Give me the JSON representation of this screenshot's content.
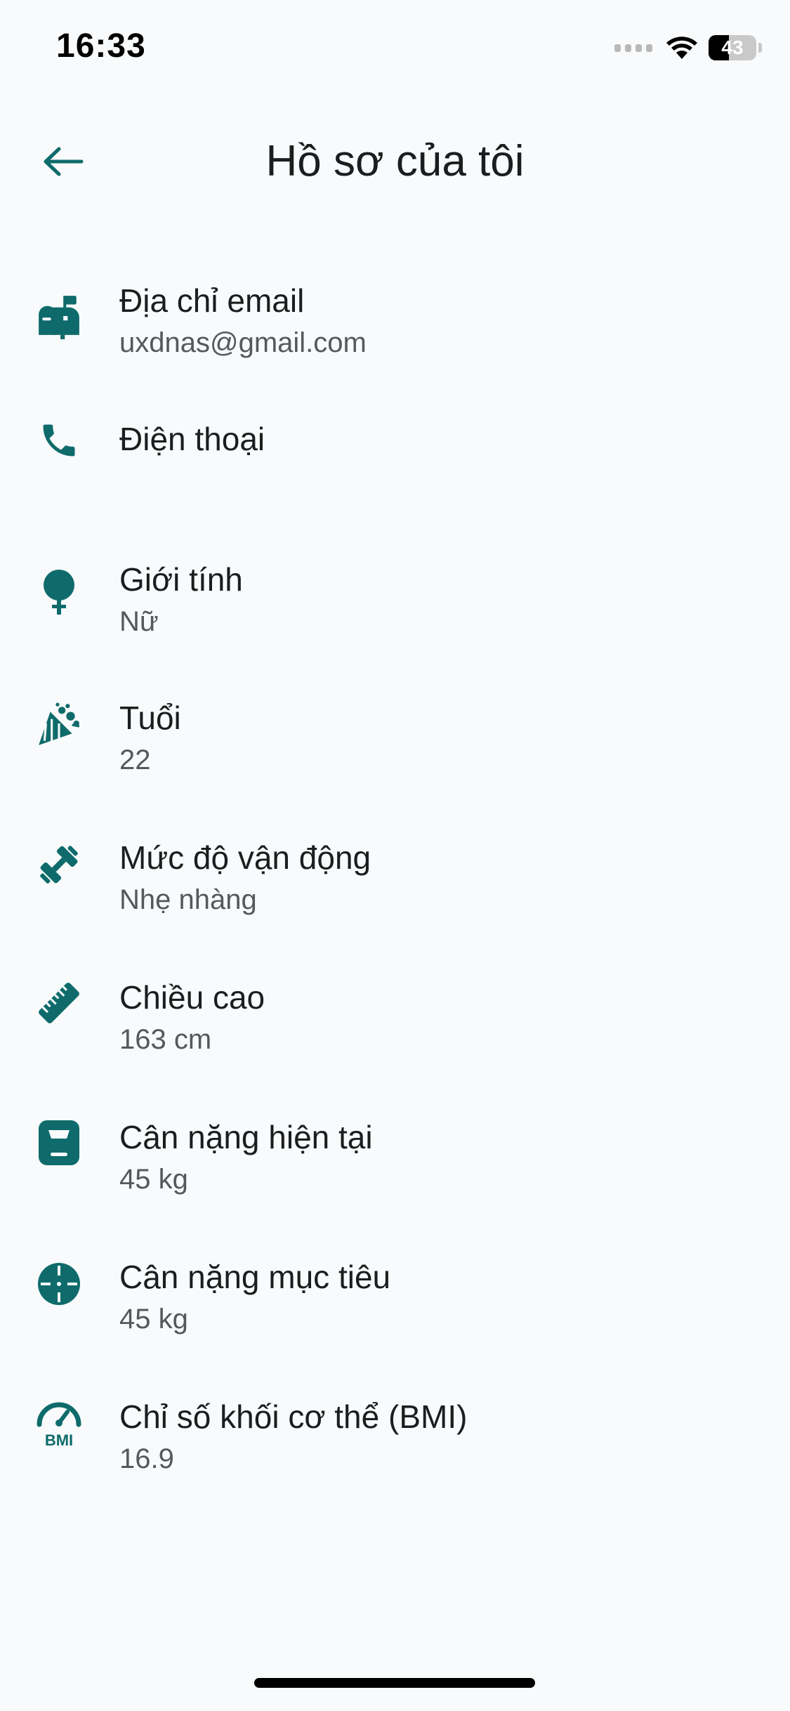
{
  "status_bar": {
    "time": "16:33",
    "battery_level": "43",
    "battery_fraction": 0.43
  },
  "header": {
    "title": "Hồ sơ của tôi",
    "back_icon": "arrow-left-icon"
  },
  "accent_color": "#0f6b6b",
  "profile": {
    "items": [
      {
        "label": "Địa chỉ email",
        "value": "uxdnas@gmail.com",
        "icon": "mailbox-icon"
      },
      {
        "label": "Điện thoại",
        "value": "",
        "icon": "phone-icon"
      },
      {
        "label": "Giới tính",
        "value": "Nữ",
        "icon": "female-icon"
      },
      {
        "label": "Tuổi",
        "value": "22",
        "icon": "party-popper-icon"
      },
      {
        "label": "Mức độ vận động",
        "value": "Nhẹ nhàng",
        "icon": "dumbbell-icon"
      },
      {
        "label": "Chiều cao",
        "value": "163 cm",
        "icon": "ruler-icon"
      },
      {
        "label": "Cân nặng hiện tại",
        "value": "45 kg",
        "icon": "scale-icon"
      },
      {
        "label": "Cân nặng mục tiêu",
        "value": "45 kg",
        "icon": "target-icon"
      },
      {
        "label": "Chỉ số khối cơ thể (BMI)",
        "value": "16.9",
        "icon": "bmi-gauge-icon",
        "icon_text": "BMI"
      }
    ]
  }
}
